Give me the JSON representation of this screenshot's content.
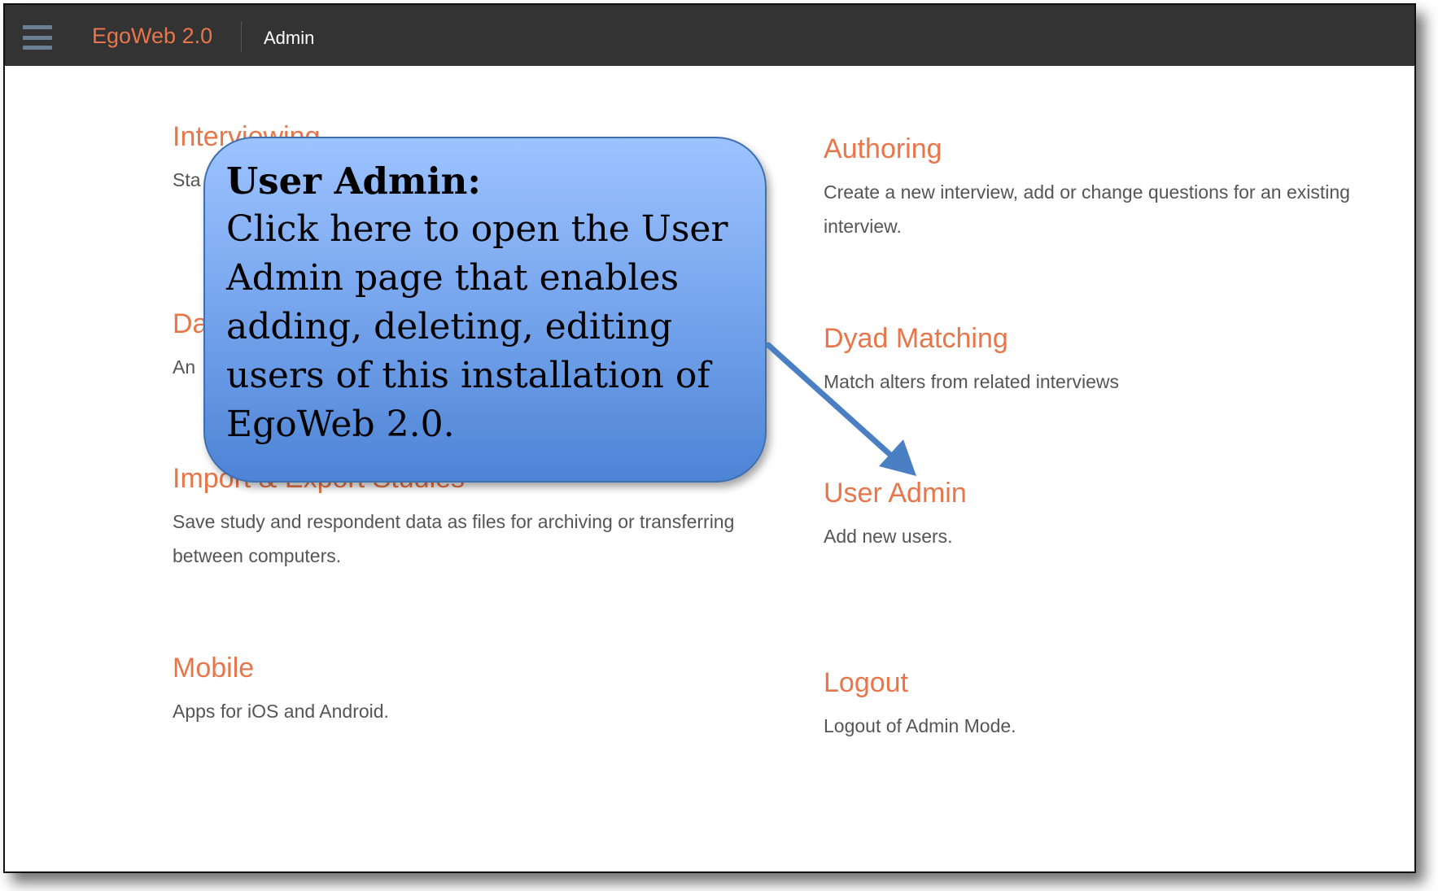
{
  "header": {
    "brand": "EgoWeb 2.0",
    "nav_admin": "Admin",
    "menu_icon": "hamburger-menu-icon"
  },
  "sections": [
    {
      "title": "Interviewing",
      "description": "Sta"
    },
    {
      "title": "Authoring",
      "description": "Create a new interview, add or change questions for an existing interview."
    },
    {
      "title": "Da",
      "description": "An"
    },
    {
      "title": "Dyad Matching",
      "description": "Match alters from related interviews"
    },
    {
      "title": "Import & Export Studies",
      "description": "Save study and respondent data as files for archiving or transferring between computers."
    },
    {
      "title": "User Admin",
      "description": "Add new users."
    },
    {
      "title": "Mobile",
      "description": "Apps for iOS and Android."
    },
    {
      "title": "Logout",
      "description": "Logout of Admin Mode."
    }
  ],
  "callout": {
    "title": "User Admin:",
    "body": "Click here to open the User Admin page that enables adding, deleting, editing users of this installation of EgoWeb 2.0."
  },
  "colors": {
    "topbar": "#333333",
    "accent": "#e8764a",
    "callout_top": "#9dc3ff",
    "callout_bottom": "#4d84d6",
    "arrow": "#4a7fc4"
  }
}
